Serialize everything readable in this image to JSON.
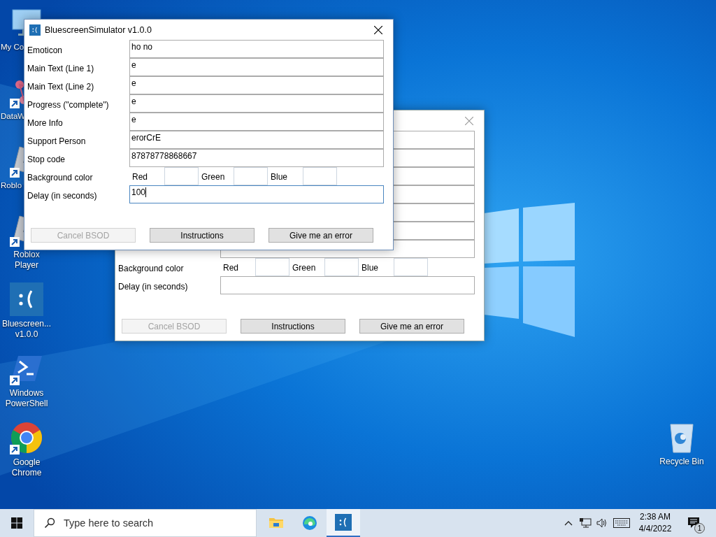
{
  "desktop_icons": [
    {
      "label": "My Co",
      "kind": "computer",
      "shortcut": false,
      "truncated": true
    },
    {
      "label": "DataW",
      "kind": "data",
      "shortcut": true,
      "truncated": true
    },
    {
      "label": "Roblo",
      "kind": "roblox",
      "shortcut": true,
      "truncated": true
    },
    {
      "label": "Roblox Player",
      "kind": "roblox",
      "shortcut": true,
      "truncated": false
    },
    {
      "label": "Bluescreen... v1.0.0",
      "kind": "bluescreen",
      "shortcut": false,
      "truncated": false
    },
    {
      "label": "Windows PowerShell",
      "kind": "powershell",
      "shortcut": true,
      "truncated": false
    },
    {
      "label": "Google Chrome",
      "kind": "chrome",
      "shortcut": true,
      "truncated": false
    },
    {
      "label": "Recycle Bin",
      "kind": "recycle",
      "shortcut": false,
      "truncated": false
    }
  ],
  "windows": [
    {
      "title": "BluescreenSimulator v1.0.0",
      "active": true,
      "rows": [
        {
          "kind": "text",
          "label": "Emoticon",
          "value": "ho no",
          "focused": false
        },
        {
          "kind": "text",
          "label": "Main Text (Line 1)",
          "value": "e",
          "focused": false
        },
        {
          "kind": "text",
          "label": "Main Text (Line 2)",
          "value": "e",
          "focused": false
        },
        {
          "kind": "text",
          "label": "Progress (\"complete\")",
          "value": "e",
          "focused": false
        },
        {
          "kind": "text",
          "label": "More Info",
          "value": "e",
          "focused": false
        },
        {
          "kind": "text",
          "label": "Support Person",
          "value": "erorCrE",
          "focused": false
        },
        {
          "kind": "text",
          "label": "Stop code",
          "value": "87878778868667",
          "focused": false
        },
        {
          "kind": "color",
          "label": "Background color",
          "channels": [
            "Red",
            "Green",
            "Blue"
          ]
        },
        {
          "kind": "text",
          "label": "Delay (in seconds)",
          "value": "100",
          "focused": true
        }
      ],
      "buttons": [
        {
          "label": "Cancel BSOD",
          "disabled": true
        },
        {
          "label": "Instructions",
          "disabled": false
        },
        {
          "label": "Give me an error",
          "disabled": false
        }
      ]
    },
    {
      "active": false,
      "rows": [
        {
          "kind": "text",
          "focused": false
        },
        {
          "kind": "text",
          "focused": false
        },
        {
          "kind": "text",
          "focused": false
        },
        {
          "kind": "text",
          "focused": false
        },
        {
          "kind": "text",
          "focused": false
        },
        {
          "kind": "text",
          "focused": false
        },
        {
          "kind": "text",
          "focused": false
        },
        {
          "kind": "color",
          "label": "Background color",
          "channels": [
            "Red",
            "Green",
            "Blue"
          ]
        },
        {
          "kind": "text",
          "label": "Delay (in seconds)",
          "focused": false
        }
      ],
      "buttons": [
        {
          "label": "Cancel BSOD",
          "disabled": true
        },
        {
          "label": "Instructions",
          "disabled": false
        },
        {
          "label": "Give me an error",
          "disabled": false
        }
      ]
    }
  ],
  "taskbar": {
    "search": {
      "placeholder": "Type here to search"
    },
    "apps": [
      {
        "kind": "explorer",
        "selected": false
      },
      {
        "kind": "edge",
        "selected": false
      },
      {
        "kind": "bluescreen",
        "selected": true
      }
    ],
    "clock": {
      "time": "2:38 AM",
      "date": "4/4/2022"
    },
    "notifications": {
      "count": "1"
    }
  }
}
